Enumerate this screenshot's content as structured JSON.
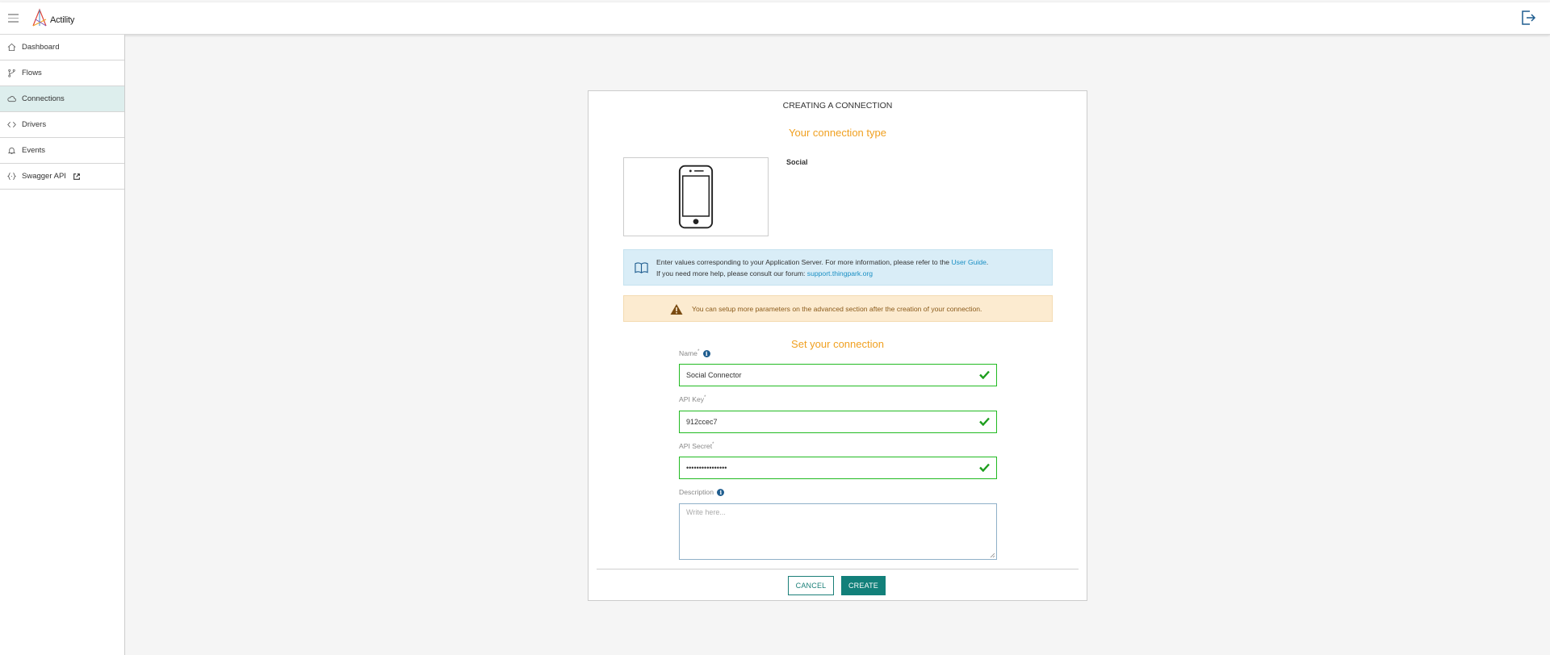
{
  "app": {
    "brand_name": "Actility"
  },
  "sidebar": {
    "items": [
      {
        "label": "Dashboard",
        "icon": "home-icon",
        "active": false
      },
      {
        "label": "Flows",
        "icon": "branch-icon",
        "active": false
      },
      {
        "label": "Connections",
        "icon": "cloud-icon",
        "active": true
      },
      {
        "label": "Drivers",
        "icon": "code-icon",
        "active": false
      },
      {
        "label": "Events",
        "icon": "bell-icon",
        "active": false
      },
      {
        "label": "Swagger API",
        "icon": "braces-icon",
        "active": false,
        "external_icon": "external-link-icon"
      }
    ]
  },
  "modal": {
    "title": "CREATING A CONNECTION",
    "type_section_title": "Your connection type",
    "connection_type": "Social",
    "info": {
      "line1_prefix": "Enter values corresponding to your Application Server. For more information, please refer to the ",
      "line1_link": "User Guide",
      "line1_suffix": ".",
      "line2_prefix": "If you need more help, please consult our forum: ",
      "line2_link": "support.thingpark.org"
    },
    "warning": "You can setup more parameters on the advanced section after the creation of your connection.",
    "set_section_title": "Set your connection",
    "fields": {
      "name": {
        "label": "Name",
        "required": "*",
        "value": "Social Connector"
      },
      "api_key": {
        "label": "API Key",
        "required": "*",
        "value": "912ccec7"
      },
      "api_secret": {
        "label": "API Secret",
        "required": "*",
        "value": "••••••••••••••••"
      },
      "description": {
        "label": "Description",
        "placeholder": "Write here...",
        "value": ""
      }
    },
    "buttons": {
      "cancel": "CANCEL",
      "create": "CREATE"
    }
  },
  "colors": {
    "accent": "#12807a",
    "section_title": "#f0a020",
    "valid": "#22bb22",
    "active_nav": "#ddeeed"
  }
}
